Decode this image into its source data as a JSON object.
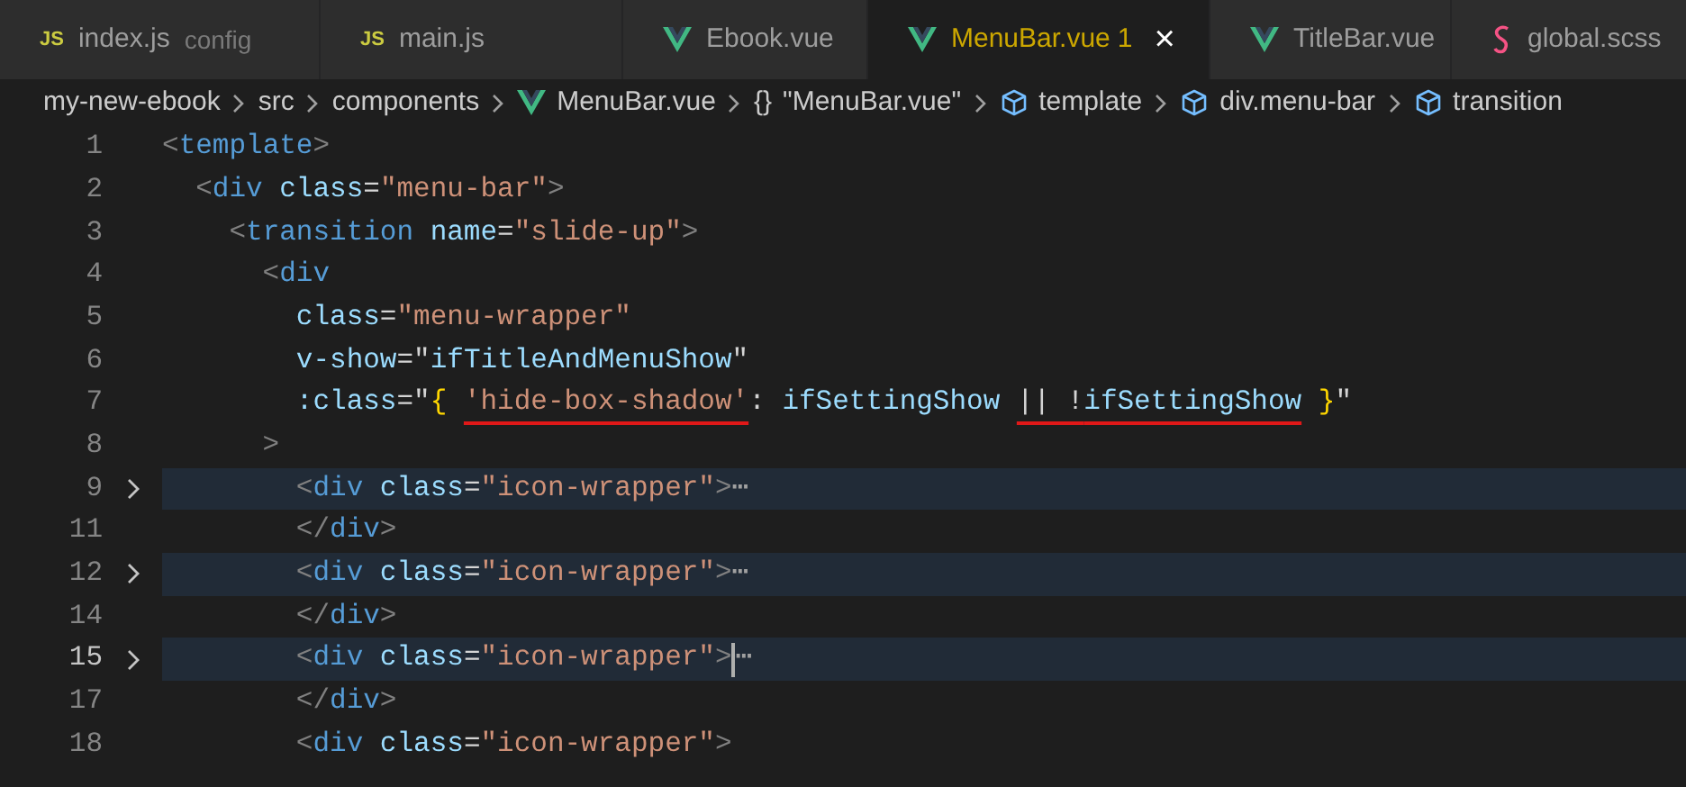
{
  "tabs": [
    {
      "kind": "js",
      "badge": "JS",
      "label": "index.js",
      "description": "config",
      "selected": false
    },
    {
      "kind": "js",
      "badge": "JS",
      "label": "main.js",
      "selected": false
    },
    {
      "kind": "vue",
      "label": "Ebook.vue",
      "selected": false
    },
    {
      "kind": "vue",
      "label": "MenuBar.vue",
      "problems": "1",
      "close": "×",
      "selected": true
    },
    {
      "kind": "vue",
      "label": "TitleBar.vue",
      "selected": false
    },
    {
      "kind": "scss",
      "label": "global.scss",
      "selected": false
    }
  ],
  "breadcrumbs": [
    {
      "kind": "folder",
      "label": "my-new-ebook"
    },
    {
      "kind": "folder",
      "label": "src"
    },
    {
      "kind": "folder",
      "label": "components"
    },
    {
      "kind": "vue",
      "label": "MenuBar.vue"
    },
    {
      "kind": "braces",
      "badge": "{}",
      "label": "\"MenuBar.vue\""
    },
    {
      "kind": "element",
      "label": "template"
    },
    {
      "kind": "element",
      "label": "div.menu-bar"
    },
    {
      "kind": "element",
      "label": "transition"
    }
  ],
  "lines": [
    {
      "number": "1",
      "folded": false,
      "current": false,
      "tokens": [
        {
          "kind": "punct",
          "text": "<"
        },
        {
          "kind": "tag",
          "text": "template"
        },
        {
          "kind": "punct",
          "text": ">"
        }
      ]
    },
    {
      "number": "2",
      "folded": false,
      "current": false,
      "tokens": [
        {
          "kind": "punct",
          "text": "  <"
        },
        {
          "kind": "tag",
          "text": "div"
        },
        {
          "kind": "attr",
          "text": " class"
        },
        {
          "kind": "op",
          "text": "="
        },
        {
          "kind": "string",
          "text": "\"menu-bar\""
        },
        {
          "kind": "punct",
          "text": ">"
        }
      ]
    },
    {
      "number": "3",
      "folded": false,
      "current": false,
      "tokens": [
        {
          "kind": "punct",
          "text": "    <"
        },
        {
          "kind": "tag",
          "text": "transition"
        },
        {
          "kind": "attr",
          "text": " name"
        },
        {
          "kind": "op",
          "text": "="
        },
        {
          "kind": "string",
          "text": "\"slide-up\""
        },
        {
          "kind": "punct",
          "text": ">"
        }
      ]
    },
    {
      "number": "4",
      "folded": false,
      "current": false,
      "tokens": [
        {
          "kind": "punct",
          "text": "      <"
        },
        {
          "kind": "tag",
          "text": "div"
        }
      ]
    },
    {
      "number": "5",
      "folded": false,
      "current": false,
      "tokens": [
        {
          "kind": "attr",
          "text": "        class"
        },
        {
          "kind": "op",
          "text": "="
        },
        {
          "kind": "string",
          "text": "\"menu-wrapper\""
        }
      ]
    },
    {
      "number": "6",
      "folded": false,
      "current": false,
      "tokens": [
        {
          "kind": "attr",
          "text": "        v-show"
        },
        {
          "kind": "op",
          "text": "="
        },
        {
          "kind": "op",
          "text": "\""
        },
        {
          "kind": "var",
          "text": "ifTitleAndMenuShow"
        },
        {
          "kind": "op",
          "text": "\""
        }
      ]
    },
    {
      "number": "7",
      "folded": false,
      "current": false,
      "tokens": [
        {
          "kind": "attr",
          "text": "        :class"
        },
        {
          "kind": "op",
          "text": "=\""
        },
        {
          "kind": "brace",
          "text": "{ "
        },
        {
          "kind": "string",
          "text": "'hide-box-shadow'",
          "marked": true
        },
        {
          "kind": "op",
          "text": ": "
        },
        {
          "kind": "var",
          "text": "ifSettingShow "
        },
        {
          "kind": "op",
          "text": "|| !",
          "marked": true
        },
        {
          "kind": "var",
          "text": "ifSettingShow",
          "marked": true
        },
        {
          "kind": "brace",
          "text": " }"
        },
        {
          "kind": "op",
          "text": "\""
        }
      ]
    },
    {
      "number": "8",
      "folded": false,
      "current": false,
      "tokens": [
        {
          "kind": "punct",
          "text": "      >"
        }
      ]
    },
    {
      "number": "9",
      "folded": true,
      "current": false,
      "ellipsis": "⋯",
      "tokens": [
        {
          "kind": "punct",
          "text": "        <"
        },
        {
          "kind": "tag",
          "text": "div"
        },
        {
          "kind": "attr",
          "text": " class"
        },
        {
          "kind": "op",
          "text": "="
        },
        {
          "kind": "string",
          "text": "\"icon-wrapper\""
        },
        {
          "kind": "punct",
          "text": ">"
        }
      ]
    },
    {
      "number": "11",
      "folded": false,
      "current": false,
      "tokens": [
        {
          "kind": "punct",
          "text": "        </"
        },
        {
          "kind": "tag",
          "text": "div"
        },
        {
          "kind": "punct",
          "text": ">"
        }
      ]
    },
    {
      "number": "12",
      "folded": true,
      "current": false,
      "ellipsis": "⋯",
      "tokens": [
        {
          "kind": "punct",
          "text": "        <"
        },
        {
          "kind": "tag",
          "text": "div"
        },
        {
          "kind": "attr",
          "text": " class"
        },
        {
          "kind": "op",
          "text": "="
        },
        {
          "kind": "string",
          "text": "\"icon-wrapper\""
        },
        {
          "kind": "punct",
          "text": ">"
        }
      ]
    },
    {
      "number": "14",
      "folded": false,
      "current": false,
      "tokens": [
        {
          "kind": "punct",
          "text": "        </"
        },
        {
          "kind": "tag",
          "text": "div"
        },
        {
          "kind": "punct",
          "text": ">"
        }
      ]
    },
    {
      "number": "15",
      "folded": true,
      "current": true,
      "ellipsis": "⋯",
      "tokens": [
        {
          "kind": "punct",
          "text": "        <"
        },
        {
          "kind": "tag",
          "text": "div"
        },
        {
          "kind": "attr",
          "text": " class"
        },
        {
          "kind": "op",
          "text": "="
        },
        {
          "kind": "string",
          "text": "\"icon-wrapper\""
        },
        {
          "kind": "punct",
          "text": ">"
        }
      ]
    },
    {
      "number": "17",
      "folded": false,
      "current": false,
      "tokens": [
        {
          "kind": "punct",
          "text": "        </"
        },
        {
          "kind": "tag",
          "text": "div"
        },
        {
          "kind": "punct",
          "text": ">"
        }
      ]
    },
    {
      "number": "18",
      "folded": false,
      "current": false,
      "tokens": [
        {
          "kind": "punct",
          "text": "        <"
        },
        {
          "kind": "tag",
          "text": "div"
        },
        {
          "kind": "attr",
          "text": " class"
        },
        {
          "kind": "op",
          "text": "="
        },
        {
          "kind": "string",
          "text": "\"icon-wrapper\""
        },
        {
          "kind": "punct",
          "text": ">"
        }
      ]
    }
  ]
}
